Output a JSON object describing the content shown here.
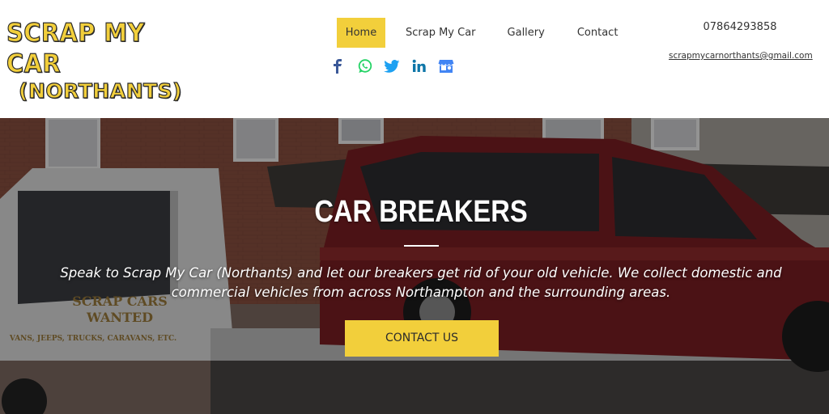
{
  "logo": {
    "line1": "SCRAP MY CAR",
    "line2": "(NORTHANTS)"
  },
  "nav": {
    "items": [
      {
        "label": "Home",
        "active": true
      },
      {
        "label": "Scrap My Car",
        "active": false
      },
      {
        "label": "Gallery",
        "active": false
      },
      {
        "label": "Contact",
        "active": false
      }
    ]
  },
  "socials": [
    "facebook-icon",
    "whatsapp-icon",
    "twitter-icon",
    "linkedin-icon",
    "google-business-icon"
  ],
  "contact": {
    "phone": "07864293858",
    "email": "scrapmycarnorthants@gmail.com"
  },
  "hero": {
    "title": "CAR BREAKERS",
    "text": "Speak to Scrap My Car (Northants) and let our breakers get rid of your old vehicle. We collect domestic and commercial vehicles from across Northampton and the surrounding areas.",
    "cta_label": "CONTACT US",
    "truck_sign_line1": "SCRAP CARS",
    "truck_sign_line2": "WANTED",
    "truck_sign_line3": "VANS, JEEPS, TRUCKS, CARAVANS, ETC."
  },
  "colors": {
    "accent": "#f2cf3b",
    "text": "#333333",
    "facebook": "#3b5998",
    "whatsapp": "#25d366",
    "twitter": "#1da1f2",
    "linkedin": "#0e76a8",
    "gmb": "#4285f4"
  }
}
